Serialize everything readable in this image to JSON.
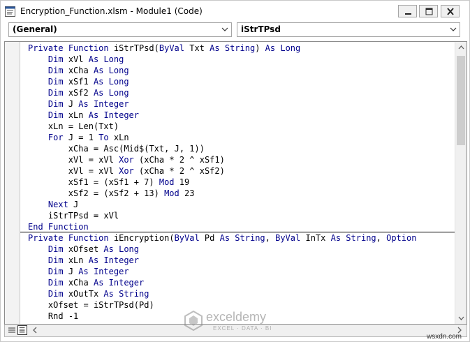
{
  "window": {
    "title": "Encryption_Function.xlsm - Module1 (Code)",
    "icons": {
      "app": "vba-module-icon",
      "minimize": "minimize-icon",
      "maximize": "maximize-icon",
      "close": "close-icon"
    }
  },
  "toolbar": {
    "object_combo": {
      "value": "(General)",
      "icon": "chevron-down-icon"
    },
    "procedure_combo": {
      "value": "iStrTPsd",
      "icon": "chevron-down-icon"
    }
  },
  "code": {
    "lines": [
      "Private Function iStrTPsd(ByVal Txt As String) As Long",
      "    Dim xVl As Long",
      "    Dim xCha As Long",
      "    Dim xSf1 As Long",
      "    Dim xSf2 As Long",
      "    Dim J As Integer",
      "    Dim xLn As Integer",
      "    xLn = Len(Txt)",
      "    For J = 1 To xLn",
      "        xCha = Asc(Mid$(Txt, J, 1))",
      "        xVl = xVl Xor (xCha * 2 ^ xSf1)",
      "        xVl = xVl Xor (xCha * 2 ^ xSf2)",
      "        xSf1 = (xSf1 + 7) Mod 19",
      "        xSf2 = (xSf2 + 13) Mod 23",
      "    Next J",
      "    iStrTPsd = xVl",
      "End Function",
      "Private Function iEncryption(ByVal Pd As String, ByVal InTx As String, Option",
      "    Dim xOfset As Long",
      "    Dim xLn As Integer",
      "    Dim J As Integer",
      "    Dim xCha As Integer",
      "    Dim xOutTx As String",
      "    xOfset = iStrTPsd(Pd)",
      "    Rnd -1"
    ],
    "keywords": [
      "Private",
      "Function",
      "ByVal",
      "As",
      "String",
      "Long",
      "Dim",
      "Integer",
      "For",
      "To",
      "Xor",
      "Mod",
      "Next",
      "End",
      "Option"
    ],
    "keyword_color": "#00008b",
    "text_color": "#000000"
  },
  "statusbar": {
    "icons": [
      "procedure-view-icon",
      "full-module-view-icon",
      "scroll-left-icon",
      "scroll-right-icon"
    ]
  },
  "watermark": {
    "name": "exceldemy",
    "tagline": "EXCEL · DATA · BI"
  },
  "site": "wsxdn.com",
  "colors": {
    "border": "#a5a5a5",
    "button_bg": "#f0f0f0",
    "watermark": "#7a7a7a"
  }
}
